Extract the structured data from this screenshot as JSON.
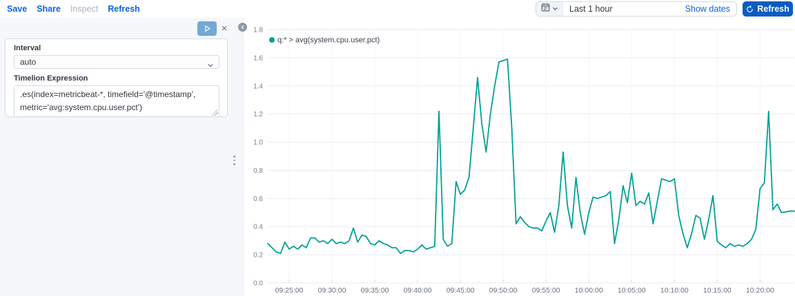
{
  "header": {
    "links": [
      {
        "label": "Save",
        "disabled": false
      },
      {
        "label": "Share",
        "disabled": false
      },
      {
        "label": "Inspect",
        "disabled": true
      },
      {
        "label": "Refresh",
        "disabled": false
      }
    ],
    "timepicker": {
      "value": "Last 1 hour",
      "show_dates": "Show dates"
    },
    "refresh_button": {
      "label": "Refresh"
    }
  },
  "editor": {
    "interval_label": "Interval",
    "interval_value": "auto",
    "expression_label": "Timelion Expression",
    "expression_value": ".es(index=metricbeat-*, timefield='@timestamp', metric='avg:system.cpu.user.pct')"
  },
  "icons": {
    "timepicker": [
      "calendar-icon",
      "chevron-down-icon"
    ],
    "refresh_button": "refresh-icon",
    "editor": [
      "play-icon",
      "close-icon",
      "collapse-left-icon",
      "chevron-down-icon",
      "resize-corner-icon",
      "drag-dots-icon"
    ]
  },
  "colors": {
    "link_blue": "#0b64dd",
    "button_fill_blue": "#0a5cc2",
    "play_button_blue": "#74a8d6",
    "series_teal": "#00a096",
    "panel_bg": "#f5f7fa",
    "gridline": "#e8ebf1",
    "axis_label": "#76808e"
  },
  "chart_data": {
    "type": "line",
    "title": "",
    "xlabel": "",
    "ylabel": "",
    "grid": true,
    "legend_position": "top-left",
    "legend": [
      "q:* > avg(system.cpu.user.pct)"
    ],
    "ylim": [
      0,
      1.8
    ],
    "y_ticks": [
      0.0,
      0.2,
      0.4,
      0.6,
      0.8,
      1.0,
      1.2,
      1.4,
      1.6,
      1.8
    ],
    "x_tick_labels": [
      "09:25:00",
      "09:30:00",
      "09:35:00",
      "09:40:00",
      "09:45:00",
      "09:50:00",
      "09:55:00",
      "10:00:00",
      "10:05:00",
      "10:10:00",
      "10:15:00",
      "10:20:00"
    ],
    "start_time": "09:22:30",
    "interval_seconds": 30,
    "series": [
      {
        "name": "q:* > avg(system.cpu.user.pct)",
        "color": "#00a096",
        "values": [
          0.28,
          0.25,
          0.22,
          0.21,
          0.29,
          0.24,
          0.26,
          0.24,
          0.27,
          0.25,
          0.32,
          0.32,
          0.29,
          0.3,
          0.28,
          0.31,
          0.28,
          0.29,
          0.28,
          0.3,
          0.39,
          0.29,
          0.34,
          0.33,
          0.28,
          0.27,
          0.3,
          0.28,
          0.27,
          0.25,
          0.25,
          0.21,
          0.23,
          0.23,
          0.22,
          0.24,
          0.27,
          0.24,
          0.25,
          0.26,
          1.22,
          0.31,
          0.26,
          0.28,
          0.72,
          0.63,
          0.66,
          0.75,
          1.1,
          1.46,
          1.13,
          0.93,
          1.2,
          1.4,
          1.57,
          1.58,
          1.59,
          1.1,
          0.42,
          0.47,
          0.43,
          0.4,
          0.39,
          0.39,
          0.37,
          0.44,
          0.5,
          0.36,
          0.55,
          0.93,
          0.55,
          0.39,
          0.75,
          0.5,
          0.345,
          0.5,
          0.61,
          0.6,
          0.61,
          0.62,
          0.65,
          0.28,
          0.45,
          0.69,
          0.57,
          0.78,
          0.55,
          0.58,
          0.56,
          0.64,
          0.42,
          0.58,
          0.74,
          0.73,
          0.72,
          0.74,
          0.48,
          0.35,
          0.25,
          0.35,
          0.48,
          0.46,
          0.31,
          0.45,
          0.62,
          0.295,
          0.27,
          0.25,
          0.28,
          0.26,
          0.27,
          0.26,
          0.28,
          0.31,
          0.38,
          0.67,
          0.71,
          1.22,
          0.52,
          0.56,
          0.5,
          0.505,
          0.51,
          0.51
        ]
      }
    ]
  }
}
